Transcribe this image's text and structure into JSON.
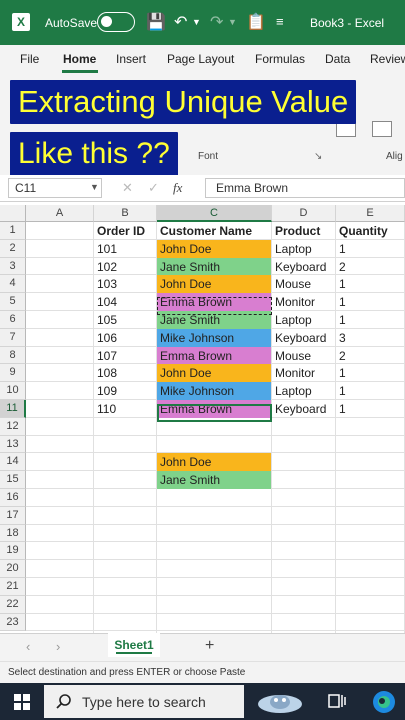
{
  "titlebar": {
    "autosave_label": "AutoSave",
    "autosave_state": "Off",
    "file_title": "Book3 - Excel"
  },
  "ribbon": {
    "tabs": [
      "File",
      "Home",
      "Insert",
      "Page Layout",
      "Formulas",
      "Data",
      "Review"
    ],
    "active_tab": "Home",
    "font_group_label": "Font",
    "align_group_label": "Alig"
  },
  "overlay": {
    "line1": "Extracting Unique Value",
    "line2": "Like this ??"
  },
  "formula_bar": {
    "name_box": "C11",
    "fx_label": "fx",
    "value": "Emma Brown"
  },
  "grid": {
    "columns": [
      "A",
      "B",
      "C",
      "D",
      "E"
    ],
    "row_numbers": [
      "1",
      "2",
      "3",
      "4",
      "5",
      "6",
      "7",
      "8",
      "9",
      "10",
      "11",
      "12",
      "13",
      "14",
      "15",
      "16",
      "17",
      "18",
      "19",
      "20",
      "21",
      "22",
      "23"
    ],
    "headers": [
      "Order ID",
      "Customer Name",
      "Product",
      "Quantity"
    ],
    "rows": [
      {
        "order_id": "101",
        "customer": "John Doe",
        "product": "Laptop",
        "quantity": "1"
      },
      {
        "order_id": "102",
        "customer": "Jane Smith",
        "product": "Keyboard",
        "quantity": "2"
      },
      {
        "order_id": "103",
        "customer": "John Doe",
        "product": "Mouse",
        "quantity": "1"
      },
      {
        "order_id": "104",
        "customer": "Emma Brown",
        "product": "Monitor",
        "quantity": "1"
      },
      {
        "order_id": "105",
        "customer": "Jane Smith",
        "product": "Laptop",
        "quantity": "1"
      },
      {
        "order_id": "106",
        "customer": "Mike Johnson",
        "product": "Keyboard",
        "quantity": "3"
      },
      {
        "order_id": "107",
        "customer": "Emma Brown",
        "product": "Mouse",
        "quantity": "2"
      },
      {
        "order_id": "108",
        "customer": "John Doe",
        "product": "Monitor",
        "quantity": "1"
      },
      {
        "order_id": "109",
        "customer": "Mike Johnson",
        "product": "Laptop",
        "quantity": "1"
      },
      {
        "order_id": "110",
        "customer": "Emma Brown",
        "product": "Keyboard",
        "quantity": "1"
      }
    ],
    "unique_list": [
      "John Doe",
      "Jane Smith"
    ],
    "customer_colors": {
      "John Doe": "#f9b51c",
      "Jane Smith": "#7fd28a",
      "Emma Brown": "#d87ed0",
      "Mike Johnson": "#4fa7e6"
    }
  },
  "sheet_tabs": {
    "active": "Sheet1",
    "add_label": "+"
  },
  "status_bar": {
    "message": "Select destination and press ENTER or choose Paste"
  },
  "taskbar": {
    "search_placeholder": "Type here to search"
  },
  "colors": {
    "excel_green": "#1f7a45",
    "overlay_bg": "#0a1f8f",
    "overlay_text": "#ffff33"
  }
}
